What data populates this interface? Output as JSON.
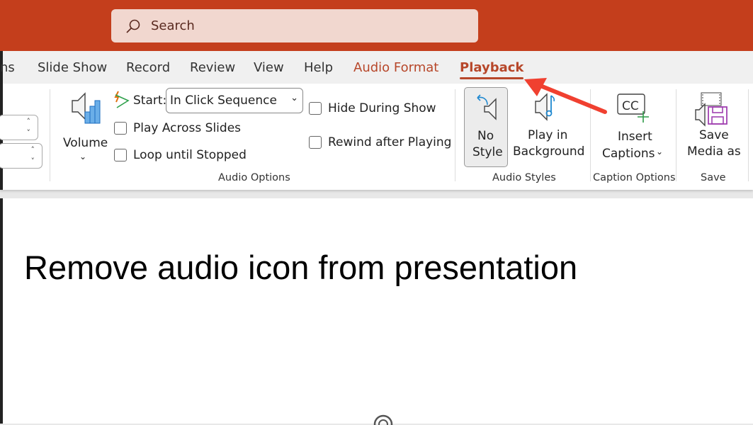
{
  "search": {
    "placeholder": "Search",
    "icon": "search-icon"
  },
  "tabs": [
    {
      "label": "ns"
    },
    {
      "label": "Slide Show"
    },
    {
      "label": "Record"
    },
    {
      "label": "Review"
    },
    {
      "label": "View"
    },
    {
      "label": "Help"
    },
    {
      "label": "Audio Format"
    },
    {
      "label": "Playback",
      "active": true
    }
  ],
  "ribbon": {
    "volume": {
      "label": "Volume"
    },
    "start": {
      "label": "Start:",
      "value": "In Click Sequence"
    },
    "checkboxes": [
      {
        "label": "Play Across Slides",
        "checked": false
      },
      {
        "label": "Loop until Stopped",
        "checked": false
      },
      {
        "label": "Hide During Show",
        "checked": false
      },
      {
        "label": "Rewind after Playing",
        "checked": false
      }
    ],
    "audio_options_label": "Audio Options",
    "no_style": {
      "line1": "No",
      "line2": "Style",
      "selected": true
    },
    "play_bg": {
      "line1": "Play in",
      "line2": "Background"
    },
    "audio_styles_label": "Audio Styles",
    "insert_captions": {
      "line1": "Insert",
      "line2": "Captions"
    },
    "caption_options_label": "Caption Options",
    "save_media": {
      "line1": "Save",
      "line2": "Media as"
    },
    "save_label": "Save",
    "cc_text": "CC"
  },
  "slide": {
    "title": "Remove audio icon from presentation"
  },
  "colors": {
    "titlebar": "#c43e1c",
    "accent": "#b7472a",
    "arrow": "#f04030"
  }
}
